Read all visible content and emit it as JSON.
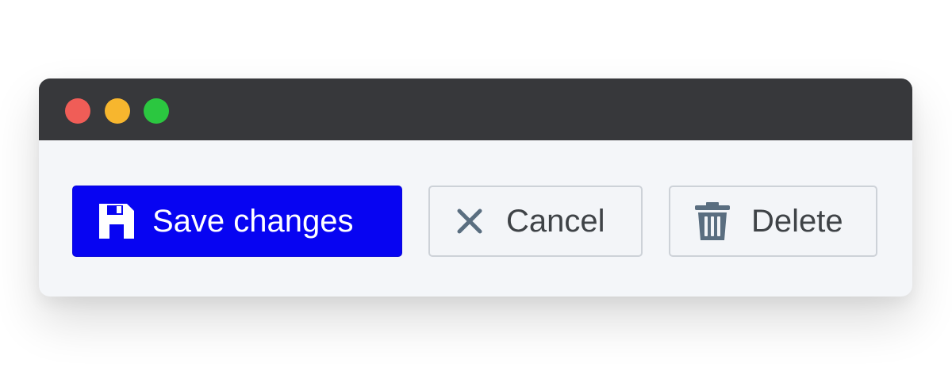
{
  "window": {
    "traffic_lights": {
      "close_color": "#f05d57",
      "minimize_color": "#f7b62e",
      "maximize_color": "#2bc740"
    }
  },
  "toolbar": {
    "save_label": "Save changes",
    "save_icon": "floppy-disk-icon",
    "cancel_label": "Cancel",
    "cancel_icon": "close-icon",
    "delete_label": "Delete",
    "delete_icon": "trash-icon"
  },
  "colors": {
    "primary": "#0704f2",
    "secondary_bg": "#f3f5f8",
    "icon_muted": "#5a6e80",
    "titlebar": "#37383b"
  }
}
